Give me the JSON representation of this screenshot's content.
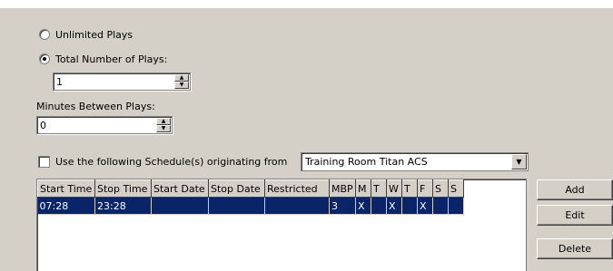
{
  "plays": {
    "unlimited_label": "Unlimited Plays",
    "total_label": "Total Number of Plays:",
    "total_value": "1",
    "selected": "total"
  },
  "minutes": {
    "label": "Minutes Between Plays:",
    "value": "0"
  },
  "schedule": {
    "checkbox_label": "Use the following Schedule(s) originating from",
    "checked": false,
    "origin_value": "Training Room Titan ACS"
  },
  "grid": {
    "columns": [
      "Start Time",
      "Stop Time",
      "Start Date",
      "Stop Date",
      "Restricted",
      "MBP",
      "M",
      "T",
      "W",
      "T",
      "F",
      "S",
      "S"
    ],
    "rows": [
      [
        "07:28",
        "23:28",
        "",
        "",
        "",
        "3",
        "X",
        "",
        "X",
        "",
        "X",
        "",
        ""
      ]
    ]
  },
  "buttons": {
    "add": "Add",
    "edit": "Edit",
    "delete": "Delete"
  },
  "colors": {
    "face": "#d4d0c8",
    "selection": "#0a246a"
  }
}
